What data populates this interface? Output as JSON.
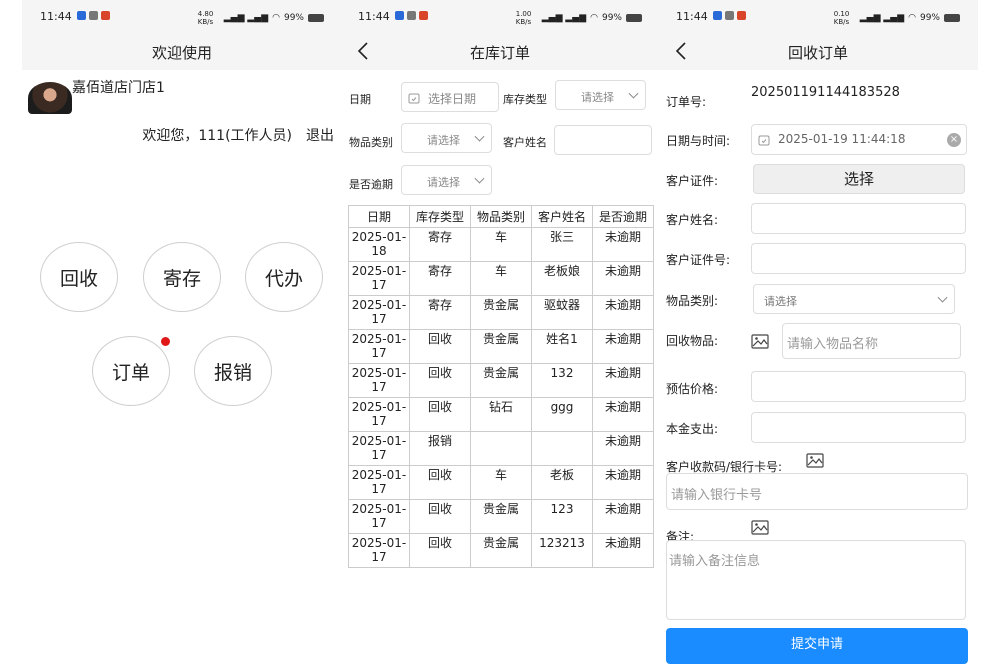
{
  "status_bars": [
    {
      "time": "11:44",
      "net": "4.80 KB/s",
      "battery": "99%"
    },
    {
      "time": "11:44",
      "net": "1.00 KB/s",
      "battery": "99%"
    },
    {
      "time": "11:44",
      "net": "0.10 KB/s",
      "battery": "99%"
    }
  ],
  "home": {
    "title": "欢迎使用",
    "store_name": "嘉佰道店门店1",
    "welcome_text": "欢迎您，111(工作人员)",
    "logout_label": "退出",
    "buttons": {
      "recycle": "回收",
      "deposit": "寄存",
      "agent": "代办",
      "order": "订单",
      "reimburse": "报销"
    }
  },
  "stock_orders": {
    "title": "在库订单",
    "filters": {
      "date_label": "日期",
      "date_placeholder": "选择日期",
      "stock_type_label": "库存类型",
      "stock_type_placeholder": "请选择",
      "category_label": "物品类别",
      "category_placeholder": "请选择",
      "customer_label": "客户姓名",
      "overdue_label": "是否逾期",
      "overdue_placeholder": "请选择"
    },
    "columns": [
      "日期",
      "库存类型",
      "物品类别",
      "客户姓名",
      "是否逾期"
    ],
    "rows": [
      [
        "2025-01-18",
        "寄存",
        "车",
        "张三",
        "未逾期"
      ],
      [
        "2025-01-17",
        "寄存",
        "车",
        "老板娘",
        "未逾期"
      ],
      [
        "2025-01-17",
        "寄存",
        "贵金属",
        "驱蚊器",
        "未逾期"
      ],
      [
        "2025-01-17",
        "回收",
        "贵金属",
        "姓名1",
        "未逾期"
      ],
      [
        "2025-01-17",
        "回收",
        "贵金属",
        "132",
        "未逾期"
      ],
      [
        "2025-01-17",
        "回收",
        "钻石",
        "ggg",
        "未逾期"
      ],
      [
        "2025-01-17",
        "报销",
        "",
        "",
        "未逾期"
      ],
      [
        "2025-01-17",
        "回收",
        "车",
        "老板",
        "未逾期"
      ],
      [
        "2025-01-17",
        "回收",
        "贵金属",
        "123",
        "未逾期"
      ],
      [
        "2025-01-17",
        "回收",
        "贵金属",
        "123213",
        "未逾期"
      ]
    ]
  },
  "recycle_order": {
    "title": "回收订单",
    "order_no_label": "订单号:",
    "order_no": "202501191144183528",
    "datetime_label": "日期与时间:",
    "datetime_value": "2025-01-19 11:44:18",
    "id_doc_label": "客户证件:",
    "id_doc_button": "选择",
    "customer_name_label": "客户姓名:",
    "id_number_label": "客户证件号:",
    "category_label": "物品类别:",
    "category_placeholder": "请选择",
    "item_label": "回收物品:",
    "item_placeholder": "请输入物品名称",
    "est_price_label": "预估价格:",
    "principal_label": "本金支出:",
    "bank_label": "客户收款码/银行卡号:",
    "bank_placeholder": "请输入银行卡号",
    "remark_label": "备注:",
    "remark_placeholder": "请输入备注信息",
    "submit_label": "提交申请"
  },
  "colors": {
    "accent": "#1a8cff",
    "badge": "#e01818"
  }
}
